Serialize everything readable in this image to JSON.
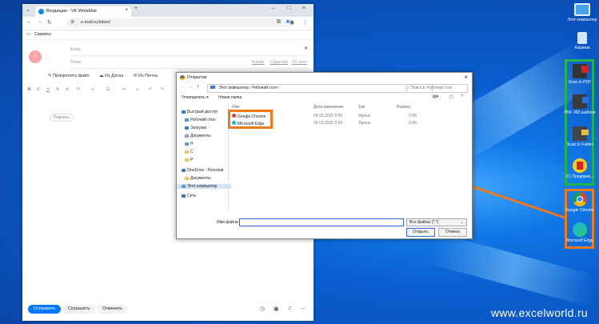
{
  "desktop": {
    "icons": [
      {
        "label": "Этот компьютер",
        "name": "this-pc-icon"
      },
      {
        "label": "Корзина",
        "name": "recycle-bin-icon"
      },
      {
        "label": "Scan to PDF",
        "name": "scan-to-pdf-icon"
      },
      {
        "label": "PDF 300 шаблон",
        "name": "pdf-300-icon"
      },
      {
        "label": "Scan to Folder",
        "name": "scan-to-folder-icon"
      },
      {
        "label": "1С Предприя...",
        "name": "1c-enterprise-icon"
      },
      {
        "label": "Google Chrome",
        "name": "google-chrome-icon"
      },
      {
        "label": "Microsoft Edge",
        "name": "microsoft-edge-icon"
      }
    ],
    "watermark": "www.excelworld.ru",
    "colors": {
      "highlight_green": "#20b34a",
      "highlight_orange": "#f07a1a"
    }
  },
  "browser": {
    "tab_title": "Входящие - VK WorkMail",
    "url": "e.mail.ru/inbox/",
    "bookmark": "Сервисы",
    "mail": {
      "to_placeholder": "Кому",
      "subject_placeholder": "Тема",
      "copy_link": "Копия",
      "bcc_link": "Скрытая",
      "from_link": "От кого",
      "avatar_letter": "I",
      "attach": "Прикрепить файл",
      "from_disk": "Из Диска",
      "from_mail": "Из Почты",
      "signature": "Подпись",
      "send": "Отправить",
      "save": "Сохранить",
      "cancel": "Отменить"
    }
  },
  "dialog": {
    "title": "Открытие",
    "breadcrumb": [
      "Этот компьютер",
      "Рабочий стол"
    ],
    "search_placeholder": "Поиск в: Рабочий стол",
    "organize": "Упорядочить",
    "new_folder": "Новая папка",
    "sidebar": [
      "Быстрый доступ",
      "Рабочий стол",
      "Загрузки",
      "Документы",
      "Н",
      "С",
      "Р",
      "OneDrive - Personal",
      "Документы",
      "Этот компьютер",
      "Сеть"
    ],
    "columns": [
      "Имя",
      "Дата изменения",
      "Тип",
      "Размер"
    ],
    "files": [
      {
        "name": "Google Chrome",
        "date": "04.03.2025 9:50",
        "type": "Ярлык",
        "size": "3 КБ"
      },
      {
        "name": "Microsoft Edge",
        "date": "04.03.2025 9:53",
        "type": "Ярлык",
        "size": "3 КБ"
      }
    ],
    "filename_label": "Имя файла:",
    "filetype": "Все файлы (*.*)",
    "open": "Открыть",
    "cancel": "Отмена"
  }
}
